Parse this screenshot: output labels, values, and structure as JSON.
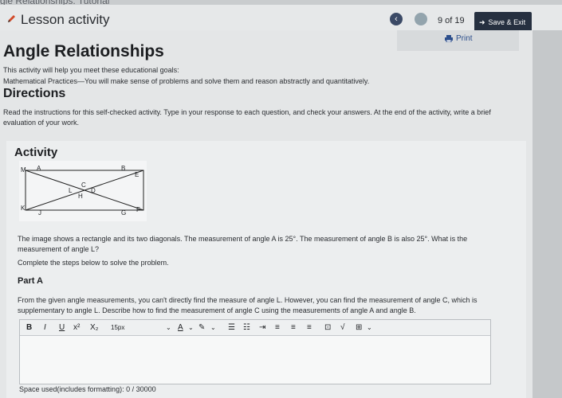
{
  "browser_tab": {
    "title": "gle Relationships: Tutorial"
  },
  "header": {
    "title": "Lesson activity",
    "page_counter": "9 of 19",
    "save_exit_label": "Save & Exit"
  },
  "print": {
    "label": "Print"
  },
  "main": {
    "title": "Angle Relationships",
    "intro": [
      "This activity will help you meet these educational goals:",
      "Mathematical Practices—You will make sense of problems and solve them and reason abstractly and quantitatively."
    ],
    "directions_heading": "Directions",
    "directions_text": "Read the instructions for this self-checked activity. Type in your response to each question, and check your answers. At the end of the activity, write a brief evaluation of your work."
  },
  "activity": {
    "heading": "Activity",
    "figure_labels": [
      "M",
      "A",
      "B",
      "E",
      "C",
      "L",
      "D",
      "H",
      "K",
      "J",
      "G",
      "F"
    ],
    "question": "The image shows a rectangle and its two diagonals. The measurement of angle A is 25°. The measurement of angle B is also 25°. What is the measurement of angle L?",
    "steps_instruction": "Complete the steps below to solve the problem.",
    "part_heading": "Part A",
    "part_a_text": "From the given angle measurements, you can't directly find the measure of angle L. However, you can find the measurement of angle C, which is supplementary to angle L. Describe how to find the measurement of angle C using the measurements of angle A and angle B."
  },
  "editor": {
    "toolbar": {
      "bold": "B",
      "italic": "I",
      "underline": "U",
      "superscript": "x²",
      "subscript": "X₂",
      "font_size": "15px",
      "font_color": "A"
    },
    "space_used": "Space used(includes formatting): 0 / 30000"
  },
  "colors": {
    "save_button": "#263040",
    "back_button": "#3b4a66",
    "link": "#2d4f8c"
  }
}
